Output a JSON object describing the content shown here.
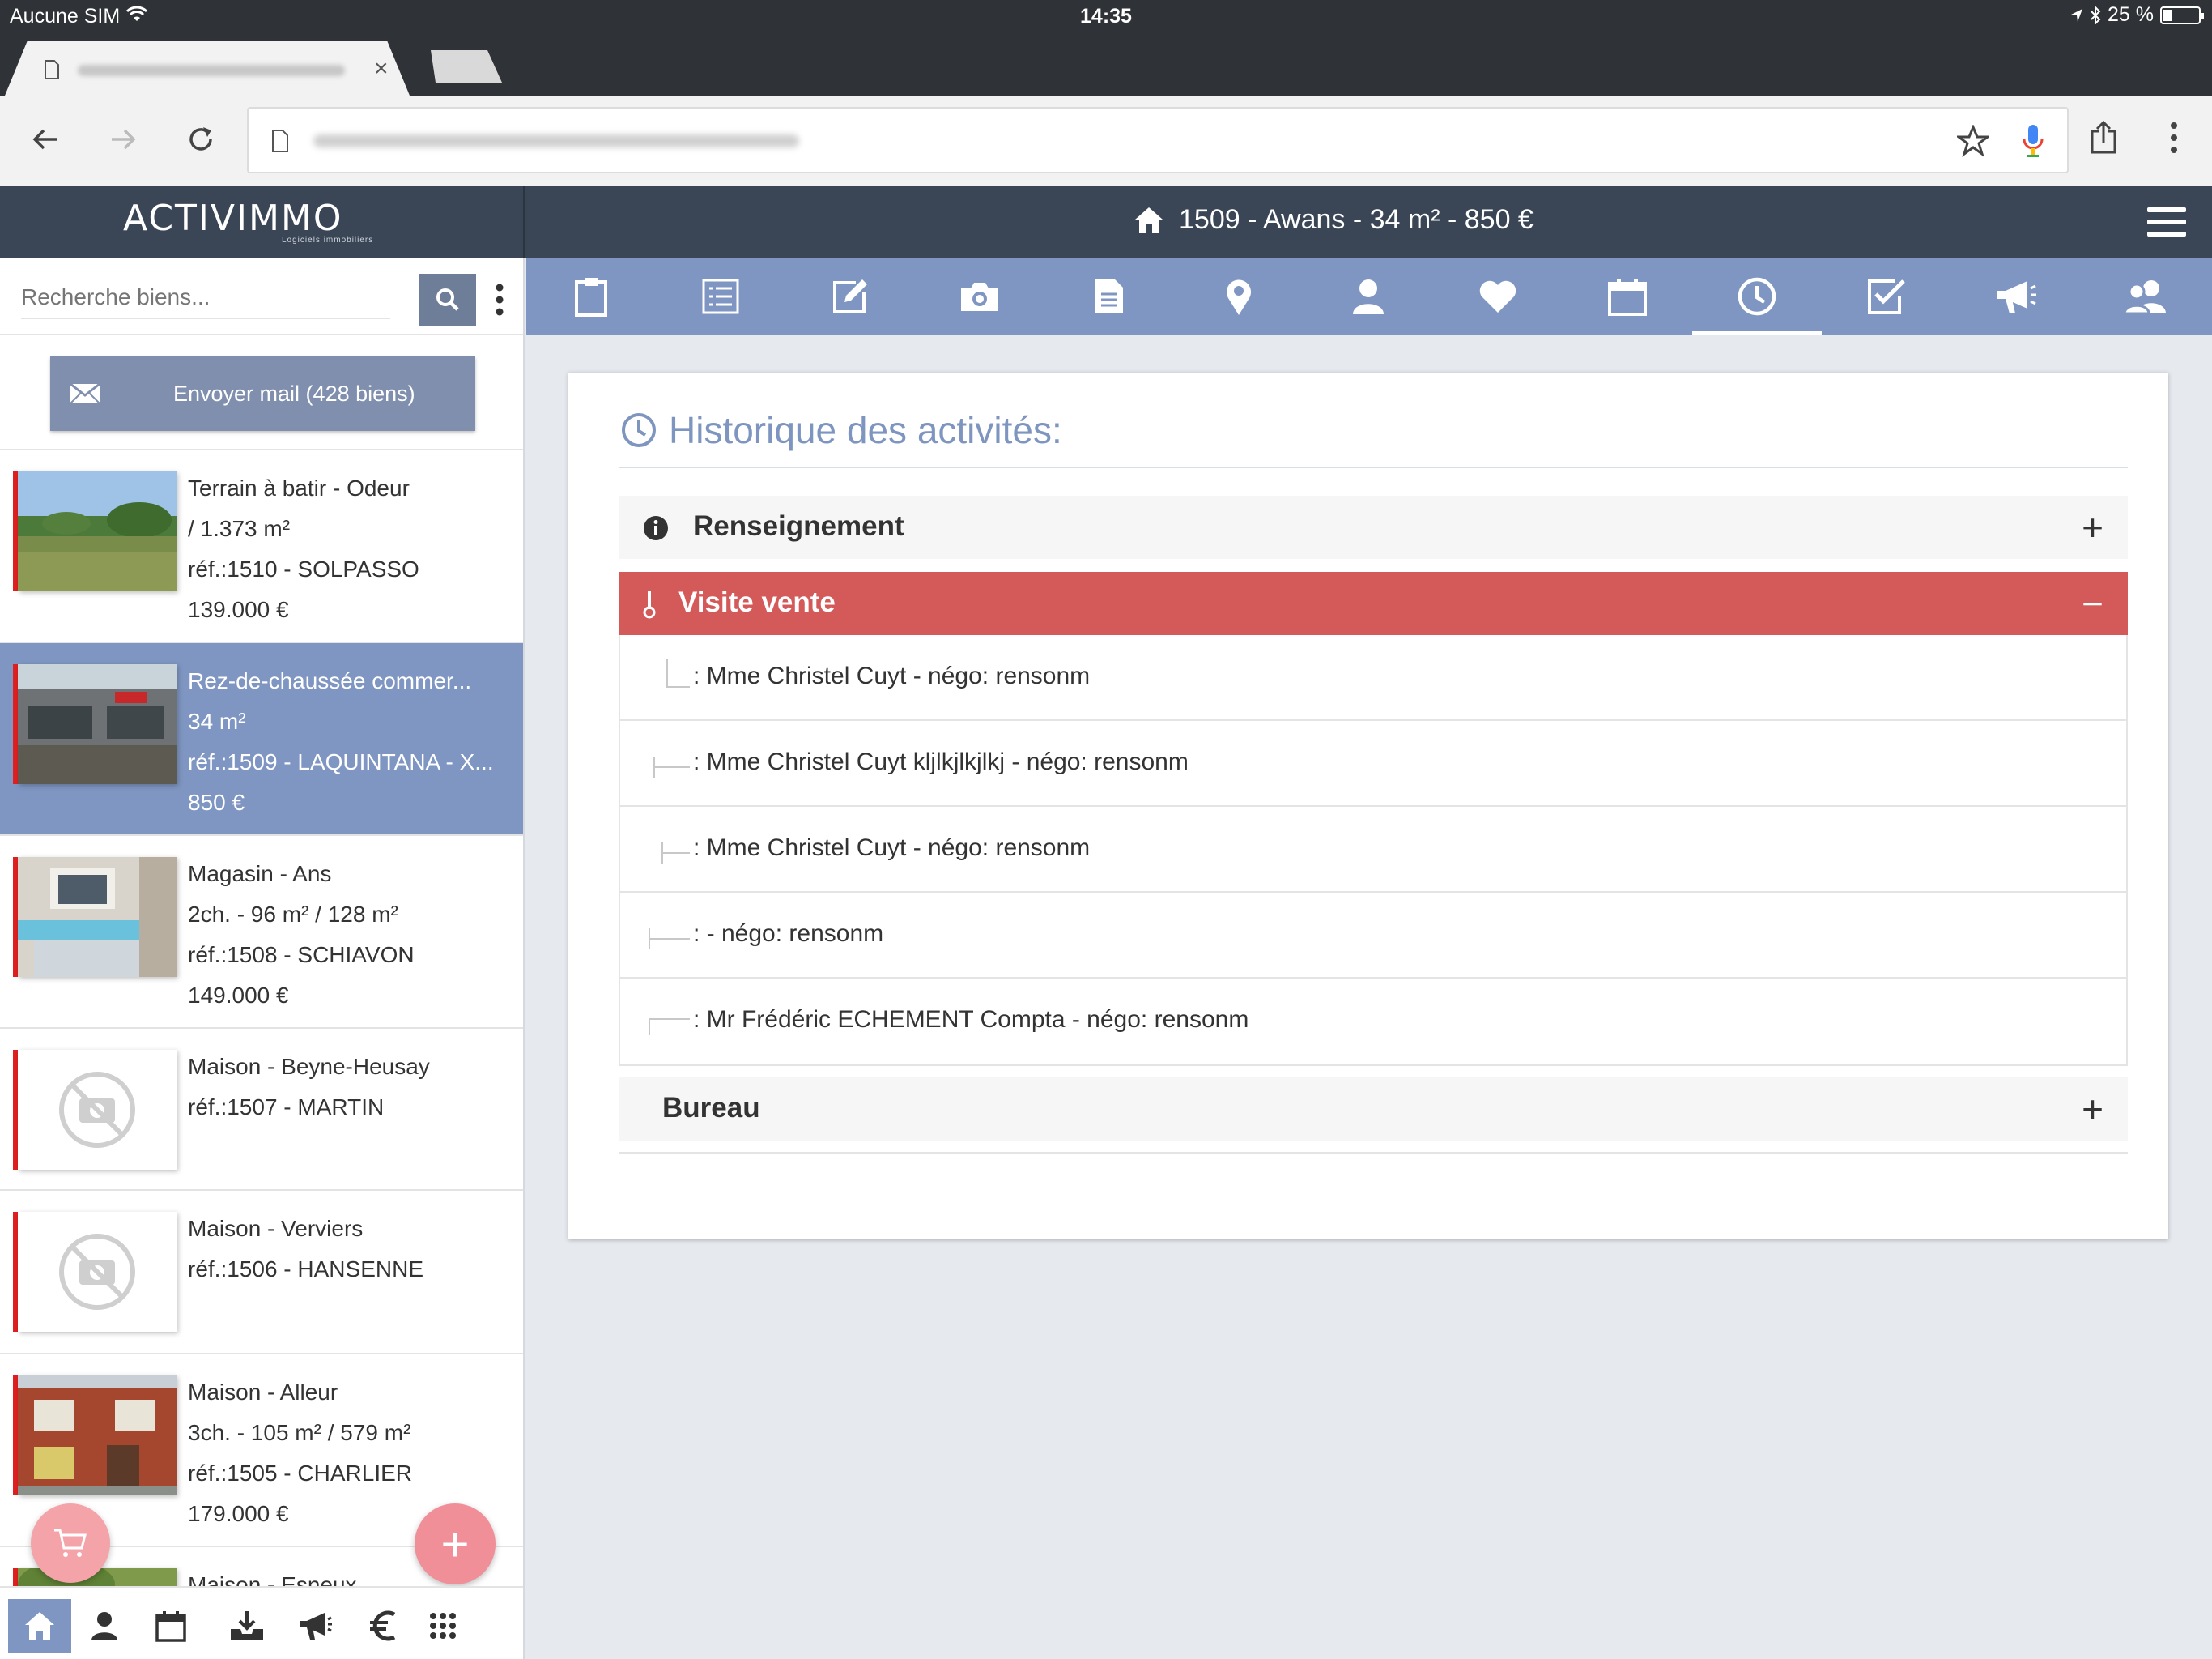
{
  "status_bar": {
    "carrier": "Aucune SIM",
    "time": "14:35",
    "battery": "25 %"
  },
  "browser": {
    "new_tab_icon": "new-tab-icon"
  },
  "app": {
    "logo": "ACTIVIMMO",
    "logo_sub": "Logiciels immobiliers",
    "property_title": "1509 - Awans - 34 m² - 850 €"
  },
  "sidebar": {
    "search_placeholder": "Recherche biens...",
    "mail_button": "Envoyer mail (428 biens)",
    "listings": [
      {
        "lines": [
          "Terrain à batir - Odeur",
          "/ 1.373 m²",
          "réf.:1510 - SOLPASSO",
          "139.000 €"
        ],
        "photo": "landscape"
      },
      {
        "lines": [
          "Rez-de-chaussée commer...",
          "34 m²",
          "réf.:1509 - LAQUINTANA - X...",
          "850 €"
        ],
        "photo": "storefront",
        "selected": true
      },
      {
        "lines": [
          "Magasin - Ans",
          "2ch. - 96 m² / 128 m²",
          "réf.:1508 - SCHIAVON",
          "149.000 €"
        ],
        "photo": "shop"
      },
      {
        "lines": [
          "Maison - Beyne-Heusay",
          "réf.:1507 - MARTIN"
        ],
        "photo": "none"
      },
      {
        "lines": [
          "Maison - Verviers",
          "réf.:1506 - HANSENNE"
        ],
        "photo": "none"
      },
      {
        "lines": [
          "Maison - Alleur",
          "3ch. - 105 m² / 579 m²",
          "réf.:1505 - CHARLIER",
          "179.000 €"
        ],
        "photo": "house"
      },
      {
        "lines": [
          "Maison - Esneux"
        ],
        "photo": "garden"
      }
    ],
    "fab_add": "+"
  },
  "content": {
    "title": "Historique des activités:",
    "sections": [
      {
        "label": "Renseignement",
        "sign": "+",
        "open": false
      },
      {
        "label": "Visite vente",
        "sign": "−",
        "open": true
      },
      {
        "label": "Bureau",
        "sign": "+",
        "open": false
      }
    ],
    "rows": [
      ": Mme Christel Cuyt - négo: rensonm",
      ": Mme Christel Cuyt kljlkjlkjlkj - négo: rensonm",
      ": Mme Christel Cuyt - négo: rensonm",
      ": - négo: rensonm",
      ": Mr Frédéric ECHEMENT Compta - négo: rensonm"
    ]
  },
  "colors": {
    "header": "#3a4656",
    "accent": "#7f96c2",
    "open_section": "#d45a5a",
    "listing_marker": "#e02020",
    "fab": "#f08f98"
  }
}
